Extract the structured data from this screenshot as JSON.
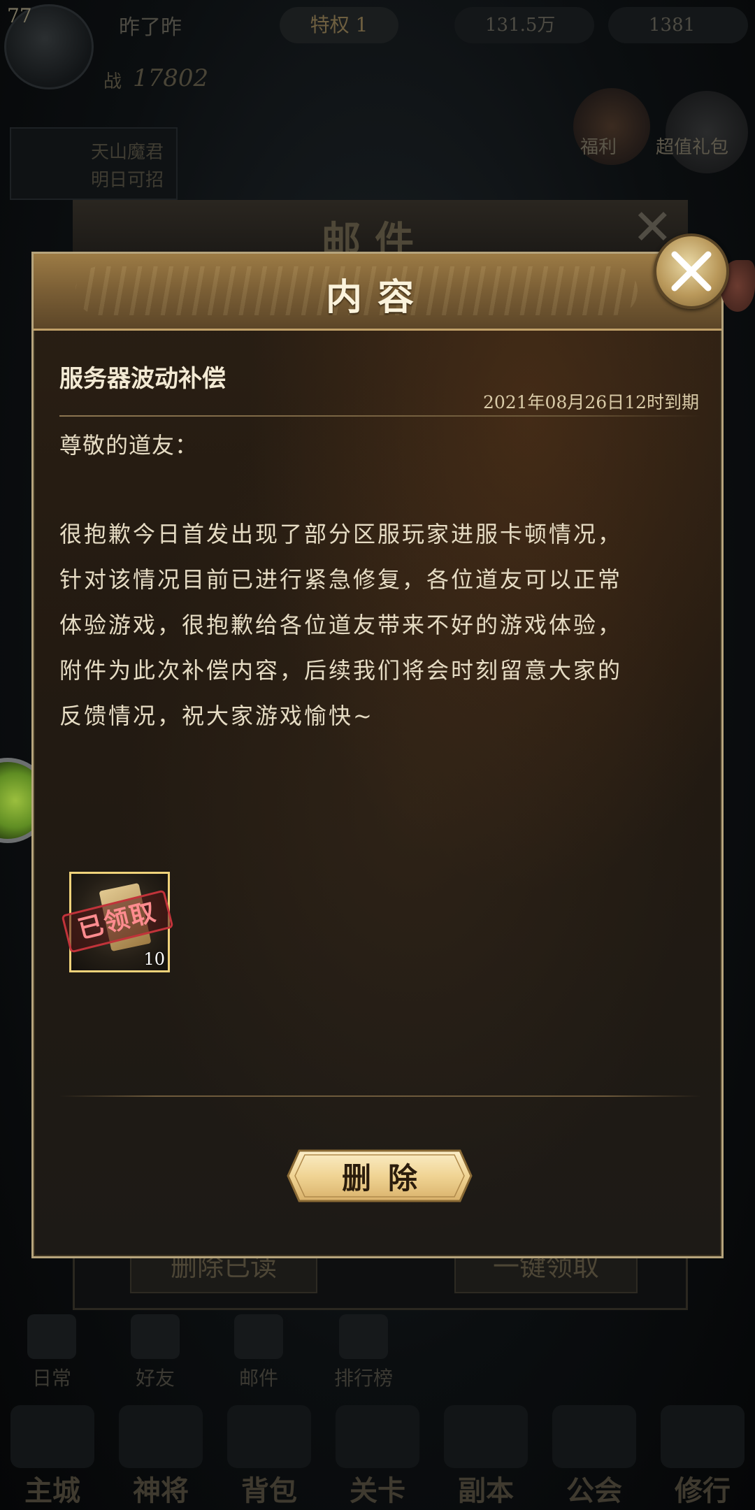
{
  "background": {
    "player_level": "77",
    "player_name": "昨了昨",
    "vip_label": "特权 1",
    "currency_gold": "131.5万",
    "currency_gem": "1381",
    "power_label": "战",
    "power_value": "17802",
    "hero_line1": "天山魔君",
    "hero_line2": "明日可招",
    "btn_left_label": "福利",
    "btn_right_label": "超值礼包",
    "mail_window_title": "邮件",
    "mail_delete_read": "删除已读",
    "mail_claim_all": "一键领取",
    "tabs": [
      "日常",
      "好友",
      "邮件",
      "排行榜"
    ],
    "nav": [
      "主城",
      "神将",
      "背包",
      "关卡",
      "副本",
      "公会",
      "修行"
    ]
  },
  "dialog": {
    "title": "内容",
    "subject": "服务器波动补偿",
    "expiry": "2021年08月26日12时到期",
    "greeting": "尊敬的道友：",
    "body_lines": [
      "很抱歉今日首发出现了部分区服玩家进服卡顿情况，",
      "针对该情况目前已进行紧急修复，各位道友可以正常",
      "体验游戏，很抱歉给各位道友带来不好的游戏体验，",
      "附件为此次补偿内容，后续我们将会时刻留意大家的",
      "反馈情况，祝大家游戏愉快~"
    ],
    "attachment": {
      "status_stamp": "已领取",
      "count": "10"
    },
    "delete_button": "删除",
    "close_icon": "close-icon"
  },
  "colors": {
    "accent_gold": "#b6a47c",
    "stamp_red": "#c1333a",
    "text_light": "#e6dcc4"
  }
}
